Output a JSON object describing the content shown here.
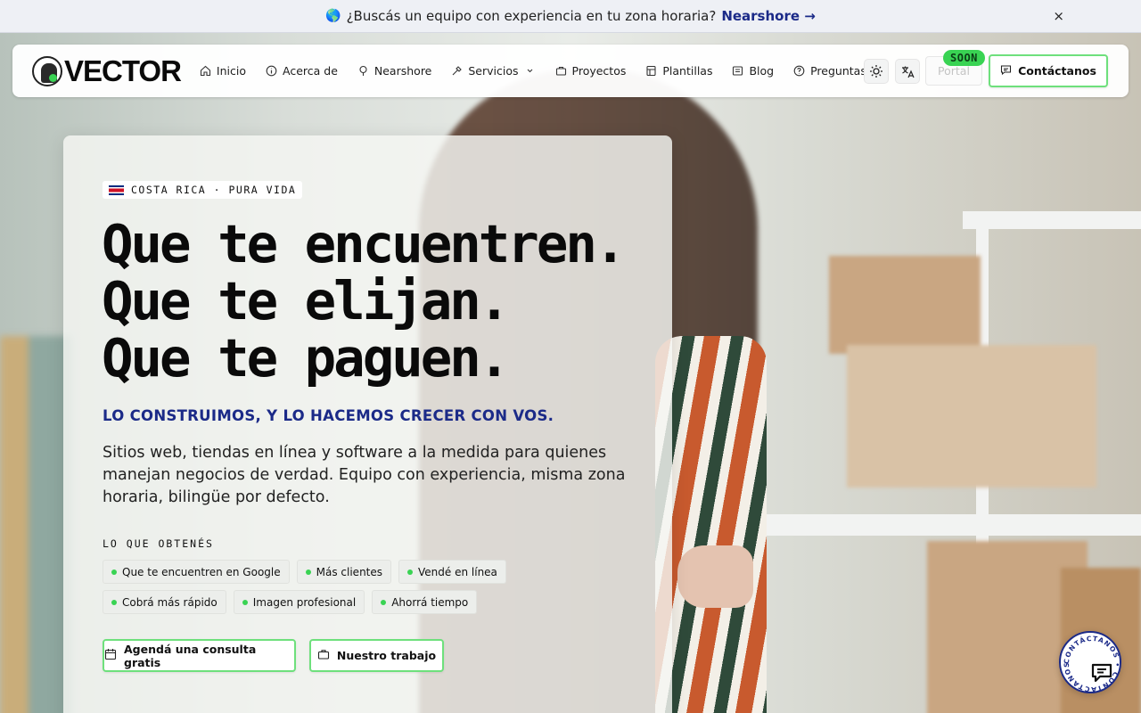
{
  "announcement": {
    "icon": "globe-icon",
    "text": "¿Buscás un equipo con experiencia en tu zona horaria?",
    "link": "Nearshore →",
    "close": "×"
  },
  "nav": {
    "logo": "VECTOR",
    "items": [
      {
        "label": "Inicio",
        "icon": "home-icon"
      },
      {
        "label": "Acerca de",
        "icon": "info-icon"
      },
      {
        "label": "Nearshore",
        "icon": "pin-icon"
      },
      {
        "label": "Servicios",
        "icon": "tools-icon",
        "dropdown": true
      },
      {
        "label": "Proyectos",
        "icon": "briefcase-icon"
      },
      {
        "label": "Plantillas",
        "icon": "template-icon"
      },
      {
        "label": "Blog",
        "icon": "blog-icon"
      },
      {
        "label": "Preguntas",
        "icon": "question-icon"
      }
    ],
    "portal": "Portal",
    "soon": "SOON",
    "contact": "Contáctanos"
  },
  "hero": {
    "badge": "COSTA RICA · PURA VIDA",
    "headline": [
      "Que te encuentren.",
      "Que te elijan.",
      "Que te paguen."
    ],
    "tagline": "LO CONSTRUIMOS, Y LO HACEMOS CRECER CON VOS.",
    "description": "Sitios web, tiendas en línea y software a la medida para quienes manejan negocios de verdad. Equipo con experiencia, misma zona horaria, bilingüe por defecto.",
    "benefits_label": "LO QUE OBTENÉS",
    "benefits": [
      "Que te encuentren en Google",
      "Más clientes",
      "Vendé en línea",
      "Cobrá más rápido",
      "Imagen profesional",
      "Ahorrá tiempo"
    ],
    "cta_primary": "Agendá una consulta gratis",
    "cta_secondary": "Nuestro trabajo"
  },
  "floating_contact": {
    "text": "CONTÁCTANOS • CONTÁCTANOS •"
  },
  "colors": {
    "accent_green": "#39d353",
    "brand_navy": "#1b2a88"
  }
}
